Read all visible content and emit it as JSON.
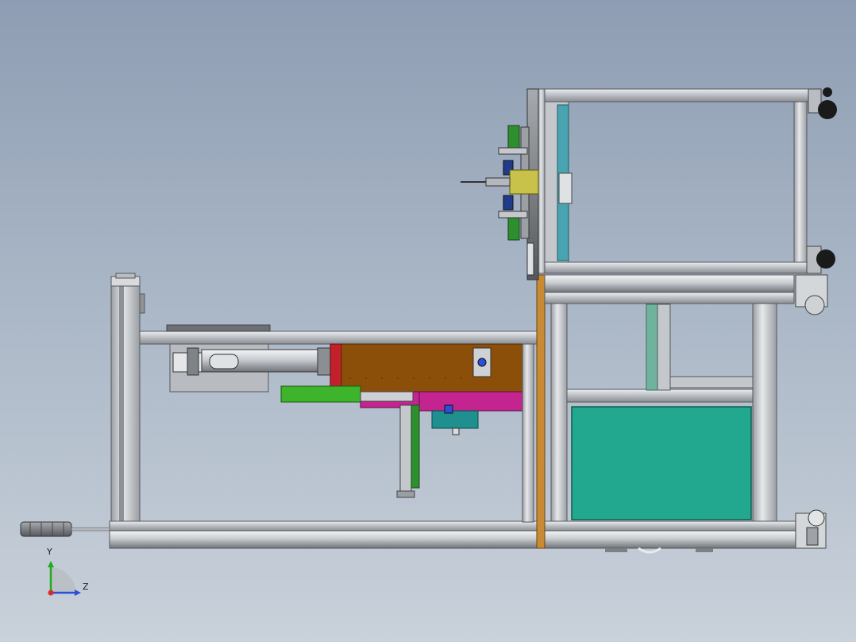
{
  "axis_triad": {
    "y_label": "Y",
    "z_label": "Z",
    "y_color": "#1faa1f",
    "z_color": "#2b4fd9",
    "x_color": "#d92b2b"
  },
  "colors": {
    "frame": "#c3c7cc",
    "frame_edge": "#55585c",
    "slide_body": "#8c4f0a",
    "slide_end": "#c2202a",
    "green_bracket": "#3db42b",
    "magenta_plate": "#c4248f",
    "teal_panel": "#23a890",
    "cyan_strip": "#4aa3b1",
    "yellow_block": "#c8c14a",
    "orange_post": "#c88a35",
    "cylinder": "#7f8488"
  }
}
